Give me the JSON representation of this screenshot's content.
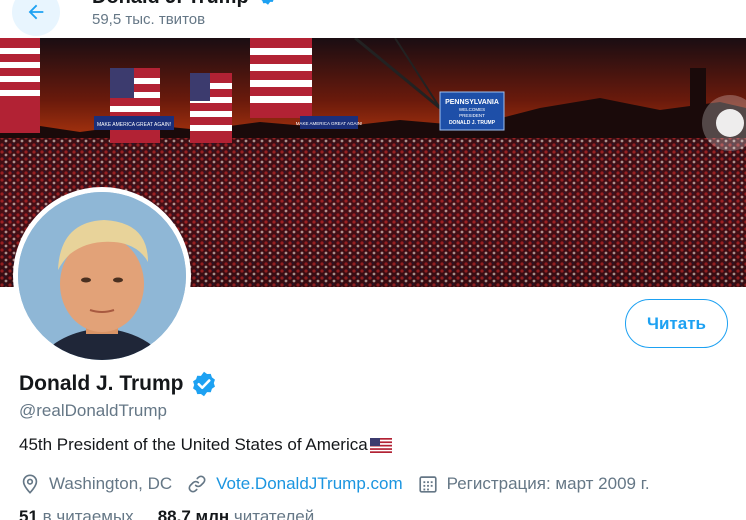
{
  "header": {
    "title": "Donald J. Trump",
    "tweet_count": "59,5 тыс. твитов"
  },
  "banner": {
    "sign_main_line1": "PENNSYLVANIA",
    "sign_main_line2": "WELCOMES",
    "sign_main_line3": "PRESIDENT",
    "sign_main_line4": "DONALD J. TRUMP",
    "sign_left": "MAKE AMERICA GREAT AGAIN!",
    "sign_right": "MAKE AMERICA GREAT AGAIN!"
  },
  "profile": {
    "follow_label": "Читать",
    "display_name": "Donald J. Trump",
    "handle": "@realDonaldTrump",
    "bio": "45th President of the United States of America",
    "location": "Washington, DC",
    "website": "Vote.DonaldJTrump.com",
    "joined": "Регистрация: март 2009 г."
  },
  "stats": {
    "following_count": "51",
    "following_label": "в читаемых",
    "followers_count": "88,7 млн",
    "followers_label": "читателей"
  },
  "colors": {
    "accent": "#1da1f2",
    "link": "#1b95e0",
    "muted": "#657786",
    "text": "#14171a"
  }
}
